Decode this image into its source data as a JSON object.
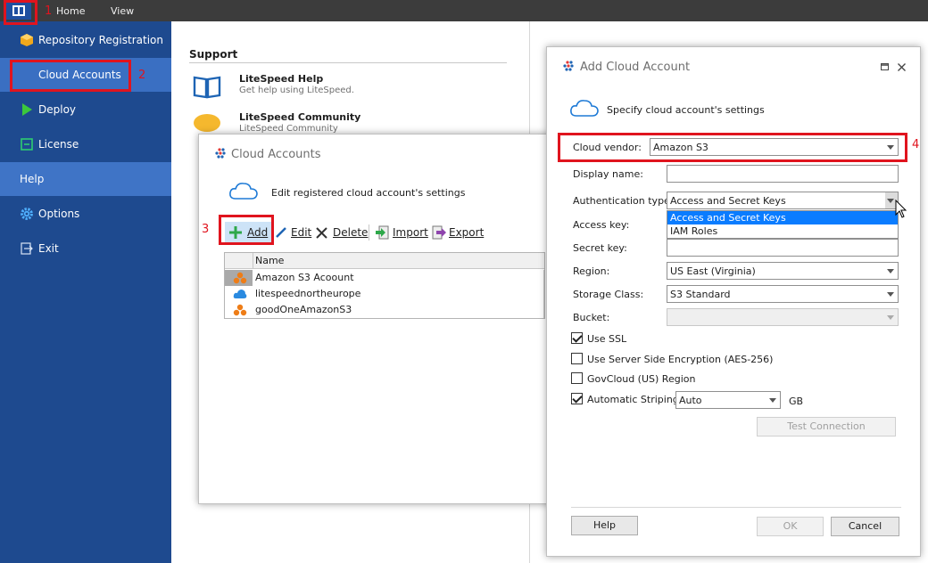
{
  "menu": {
    "home": "Home",
    "view": "View"
  },
  "callouts": [
    "1",
    "2",
    "3",
    "4"
  ],
  "sidebar": {
    "items": [
      {
        "label": "Repository Registration"
      },
      {
        "label": "Cloud Accounts"
      },
      {
        "label": "Deploy"
      },
      {
        "label": "License"
      },
      {
        "label": "Help"
      },
      {
        "label": "Options"
      },
      {
        "label": "Exit"
      }
    ]
  },
  "support": {
    "title": "Support",
    "items": [
      {
        "title": "LiteSpeed Help",
        "desc": "Get help using LiteSpeed."
      },
      {
        "title": "LiteSpeed Community",
        "desc": "LiteSpeed Community"
      }
    ]
  },
  "cloud_accounts_dialog": {
    "title": "Cloud Accounts",
    "subtitle": "Edit registered cloud account's settings",
    "toolbar": {
      "add": "Add",
      "edit": "Edit",
      "delete": "Delete",
      "import": "Import",
      "export": "Export"
    },
    "column_header": "Name",
    "rows": [
      {
        "name": "Amazon S3 Acoount",
        "icon": "amazon-s3-icon"
      },
      {
        "name": "litespeednortheurope",
        "icon": "azure-cloud-icon"
      },
      {
        "name": "goodOneAmazonS3",
        "icon": "amazon-s3-icon"
      }
    ]
  },
  "add_dialog": {
    "title": "Add Cloud Account",
    "subtitle": "Specify cloud account's settings",
    "labels": {
      "vendor": "Cloud vendor:",
      "display_name": "Display name:",
      "auth_type": "Authentication type:",
      "access_key": "Access key:",
      "secret_key": "Secret key:",
      "region": "Region:",
      "storage_class": "Storage Class:",
      "bucket": "Bucket:"
    },
    "values": {
      "vendor": "Amazon S3",
      "display_name": "",
      "auth_type": "Access and Secret Keys",
      "access_key": "",
      "secret_key": "",
      "region": "US East (Virginia)",
      "storage_class": "S3 Standard",
      "bucket": ""
    },
    "auth_options": [
      "Access and Secret Keys",
      "IAM Roles"
    ],
    "checks": {
      "use_ssl": {
        "label": "Use SSL",
        "checked": true
      },
      "sse": {
        "label": "Use Server Side Encryption (AES-256)",
        "checked": false
      },
      "govcloud": {
        "label": "GovCloud (US) Region",
        "checked": false
      },
      "striping": {
        "label": "Automatic Striping",
        "checked": true
      }
    },
    "striping_value": "Auto",
    "striping_unit": "GB",
    "buttons": {
      "test": "Test Connection",
      "help": "Help",
      "ok": "OK",
      "cancel": "Cancel"
    }
  },
  "colors": {
    "sidebar": "#1e4a8f",
    "sidebar_active": "#3a6fc2",
    "callout": "#e0141e",
    "selection": "#0a7cff"
  }
}
